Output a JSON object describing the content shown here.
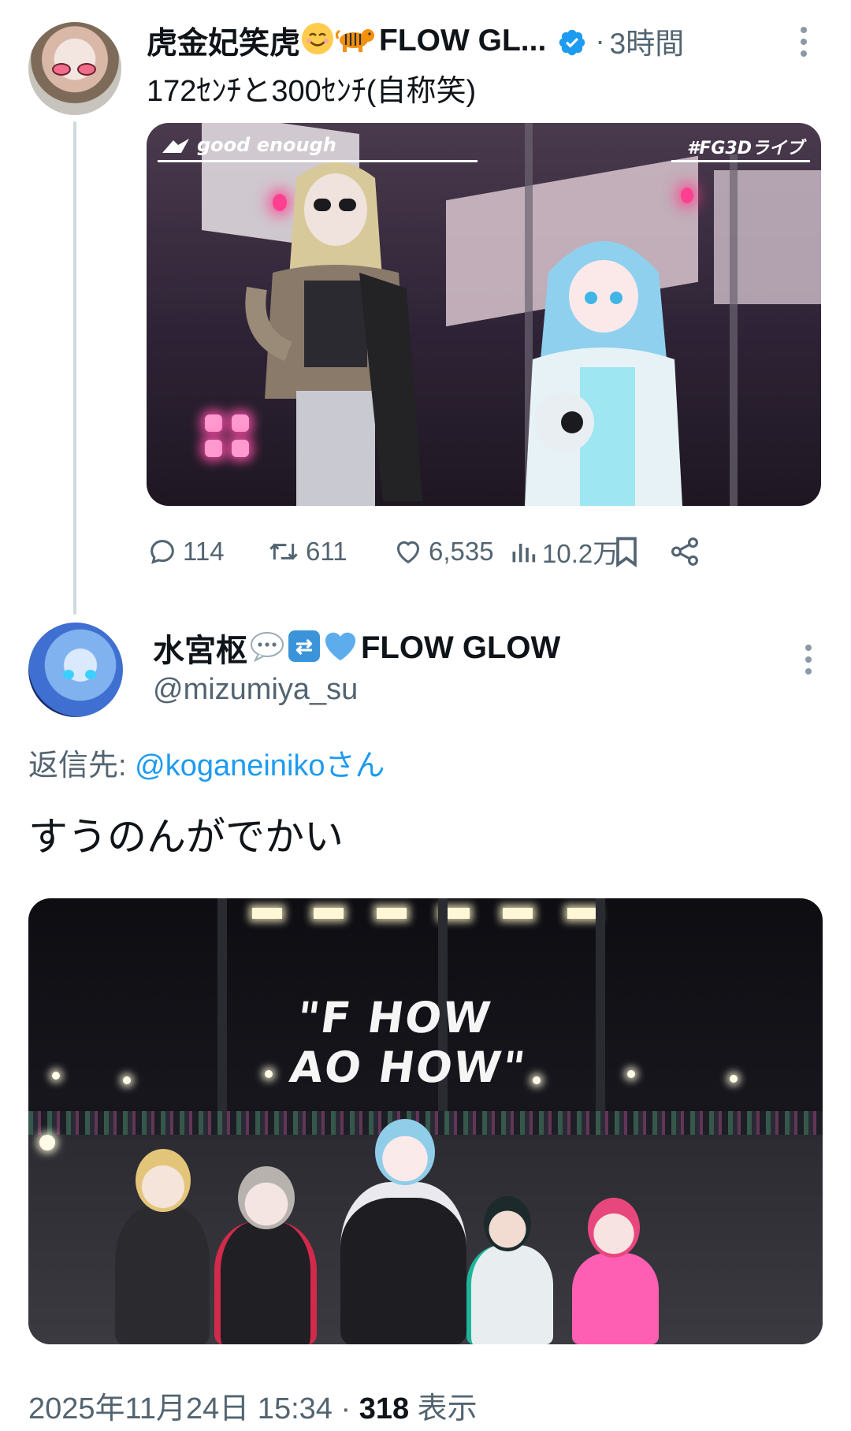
{
  "parent_tweet": {
    "author_name": "虎金妃笑虎",
    "author_name_suffix": "FLOW GL...",
    "emoji_1": "smiling-face-emoji",
    "emoji_2": "tiger-emoji",
    "verified_icon": "verified-badge-icon",
    "separator": "·",
    "time": "3時間",
    "text": "172ｾﾝﾁと300ｾﾝﾁ(自称笑)",
    "media": {
      "banner_left": "good enough",
      "banner_right": "#FG3Dライブ"
    },
    "actions": {
      "replies": "114",
      "retweets": "611",
      "likes": "6,535",
      "views": "10.2万"
    }
  },
  "reply_tweet": {
    "author_name_prefix": "水宮枢",
    "author_name_suffix": "FLOW GLOW",
    "emoji_1": "speech-bubble-emoji",
    "emoji_2": "repeat-emoji",
    "emoji_3": "blue-heart-emoji",
    "handle": "@mizumiya_su",
    "replying_to_label": "返信先: ",
    "replying_to_mention": "@koganeinikoさん",
    "text": "すうのんがでかい",
    "media": {
      "screen_text": "\"F HOW AO HOW\""
    },
    "timestamp": "2025年11月24日 15:34",
    "separator": " · ",
    "view_count": "318",
    "view_label": " 表示"
  },
  "colors": {
    "text_primary": "#0f1419",
    "text_secondary": "#536471",
    "accent_blue": "#1d9bf0",
    "thread_line": "#cfd9de"
  }
}
